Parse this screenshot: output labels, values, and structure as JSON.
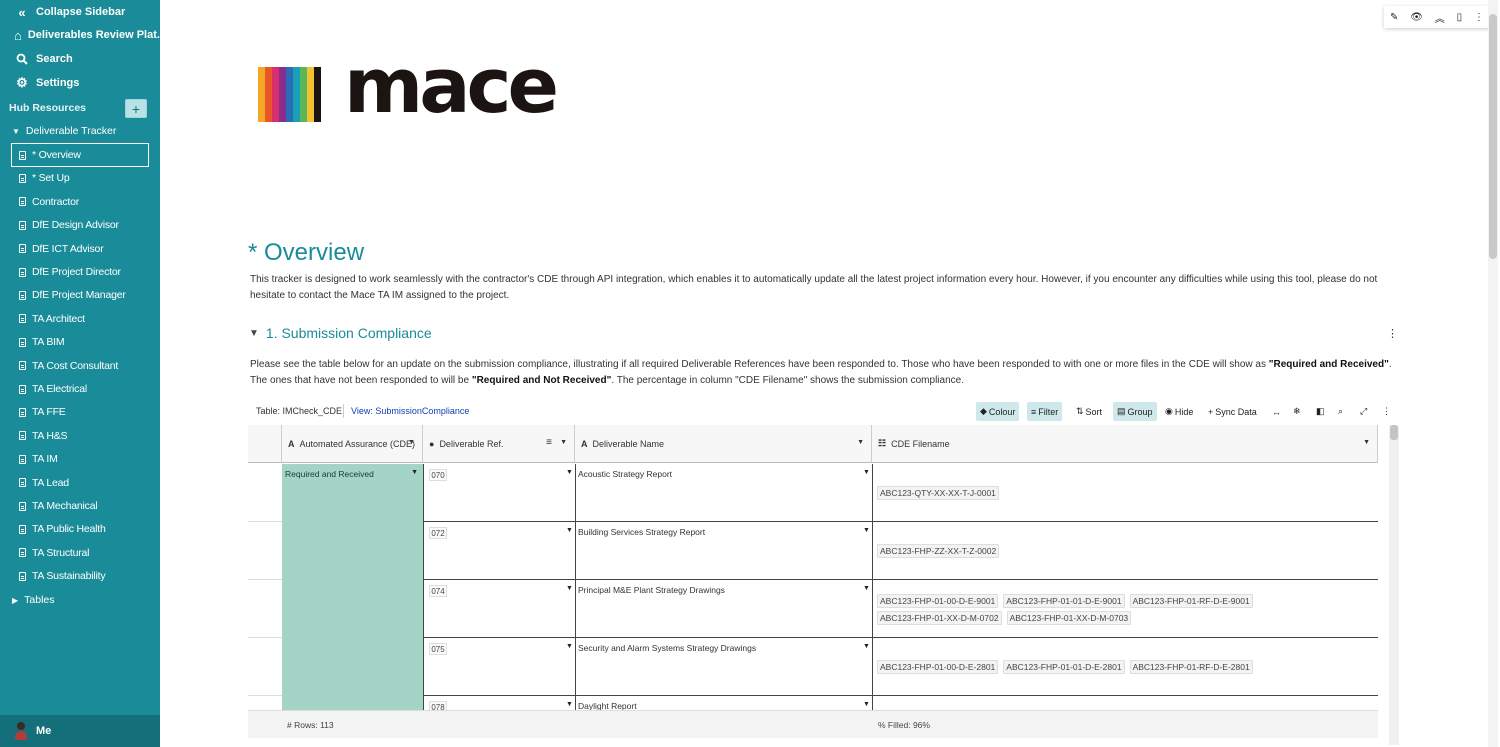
{
  "sidebar": {
    "collapse_label": "Collapse Sidebar",
    "home_label": "Deliverables Review Plat...",
    "search_label": "Search",
    "settings_label": "Settings",
    "section_label": "Hub Resources",
    "add_label": "+",
    "tracker_label": "Deliverable Tracker",
    "pages": [
      "* Overview",
      "* Set Up",
      "Contractor",
      "DfE Design Advisor",
      "DfE ICT Advisor",
      "DfE Project Director",
      "DfE Project Manager",
      "TA Architect",
      "TA BIM",
      "TA Cost Consultant",
      "TA Electrical",
      "TA FFE",
      "TA H&S",
      "TA IM",
      "TA Lead",
      "TA Mechanical",
      "TA Public Health",
      "TA Structural",
      "TA Sustainability"
    ],
    "tables_label": "Tables",
    "user_label": "Me"
  },
  "logo": {
    "text": "mace",
    "bar_colors": [
      "#f5a623",
      "#e8552a",
      "#d62f6b",
      "#8a2b8f",
      "#2a6db4",
      "#19a0b8",
      "#5bb65a",
      "#f2c230",
      "#1c1412"
    ]
  },
  "page": {
    "title": "* Overview",
    "intro": "This tracker is designed to work seamlessly with the contractor's CDE through API integration, which enables it to automatically update all the latest project information every hour. However, if you encounter any difficulties while using this tool, please do not hesitate to contact the Mace TA IM assigned to the project."
  },
  "section": {
    "title": "1. Submission Compliance",
    "desc_1": "Please see the table below for an update on the submission compliance, illustrating if all required Deliverable References have been responded to. Those who have been responded to with one or more files in the CDE will show as ",
    "desc_b1": "\"Required and Received\"",
    "desc_2": ". The ones that have not been responded to will be ",
    "desc_b2": "\"Required and Not Received\"",
    "desc_3": ". The percentage in column \"CDE Filename\" shows the submission compliance."
  },
  "table_toolbar": {
    "table_name": "Table: IMCheck_CDE",
    "view_name": "View: SubmissionCompliance",
    "colour": "Colour",
    "filter": "Filter",
    "sort": "Sort",
    "group": "Group",
    "hide": "Hide",
    "sync": "Sync Data"
  },
  "grid": {
    "columns": [
      "Automated Assurance (CDE)",
      "Deliverable Ref.",
      "Deliverable Name",
      "CDE Filename"
    ],
    "assurance_value": "Required and Received",
    "rows": [
      {
        "ref": "070",
        "name": "Acoustic Strategy Report",
        "files": [
          "ABC123-QTY-XX-XX-T-J-0001"
        ]
      },
      {
        "ref": "072",
        "name": "Building Services Strategy Report",
        "files": [
          "ABC123-FHP-ZZ-XX-T-Z-0002"
        ]
      },
      {
        "ref": "074",
        "name": "Principal M&E Plant Strategy Drawings",
        "files": [
          "ABC123-FHP-01-00-D-E-9001",
          "ABC123-FHP-01-01-D-E-9001",
          "ABC123-FHP-01-RF-D-E-9001",
          "ABC123-FHP-01-XX-D-M-0702",
          "ABC123-FHP-01-XX-D-M-0703"
        ]
      },
      {
        "ref": "075",
        "name": "Security and Alarm Systems Strategy Drawings",
        "files": [
          "ABC123-FHP-01-00-D-E-2801",
          "ABC123-FHP-01-01-D-E-2801",
          "ABC123-FHP-01-RF-D-E-2801"
        ]
      },
      {
        "ref": "078",
        "name": "Daylight Report",
        "files": []
      }
    ],
    "footer_rows": "# Rows: 113",
    "footer_filled": "% Filled: 96%"
  },
  "colors": {
    "accent": "#1a8c99",
    "sidebar": "#1a8c99",
    "assurance_fill": "#a3d4c6"
  }
}
